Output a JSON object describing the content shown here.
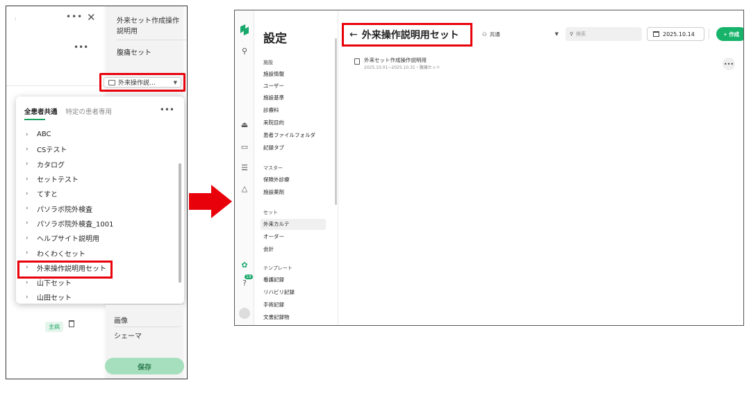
{
  "left": {
    "side_items": [
      "外来セット作成操作説明用",
      "腹痛セット"
    ],
    "folder_select_value": "外来操作説…",
    "tabs": {
      "common": "全患者共通",
      "patient": "特定の患者専用"
    },
    "tree_items": [
      "ABC",
      "CSテスト",
      "カタログ",
      "セットテスト",
      "てすと",
      "パソラボ院外検査",
      "パソラボ院外検査_1001",
      "ヘルプサイト説明用",
      "わくわくセット",
      "外来操作説明用セット",
      "山下セット",
      "山田セット"
    ],
    "lower_items": [
      "画像",
      "シェーマ"
    ],
    "tag_main": "主病",
    "save_label": "保存"
  },
  "right": {
    "nav_title": "設定",
    "sections": [
      {
        "label": "施設",
        "items": [
          "施設情報",
          "ユーザー",
          "施設基準",
          "診療科",
          "来院目的",
          "患者ファイルフォルダ",
          "記録タブ"
        ]
      },
      {
        "label": "マスター",
        "items": [
          "保険外診療",
          "施設薬剤"
        ]
      },
      {
        "label": "セット",
        "items": [
          "外来カルテ",
          "オーダー",
          "会計"
        ]
      },
      {
        "label": "テンプレート",
        "items": [
          "看護記録",
          "リハビリ記録",
          "手術記録",
          "文書記録物"
        ]
      }
    ],
    "active_item": "外来カルテ",
    "page_title": "外来操作説明用セット",
    "scope_value": "共通",
    "search_placeholder": "検索",
    "date": "2025.10.14",
    "create_label": "作成",
    "notification_count": "19",
    "list_item": {
      "title": "外来セット作成操作説明用",
      "subtitle": "2025.10.01~2025.10.31・腹痛セット"
    }
  },
  "colors": {
    "highlight": "#e8000a",
    "brand": "#18b36b"
  }
}
